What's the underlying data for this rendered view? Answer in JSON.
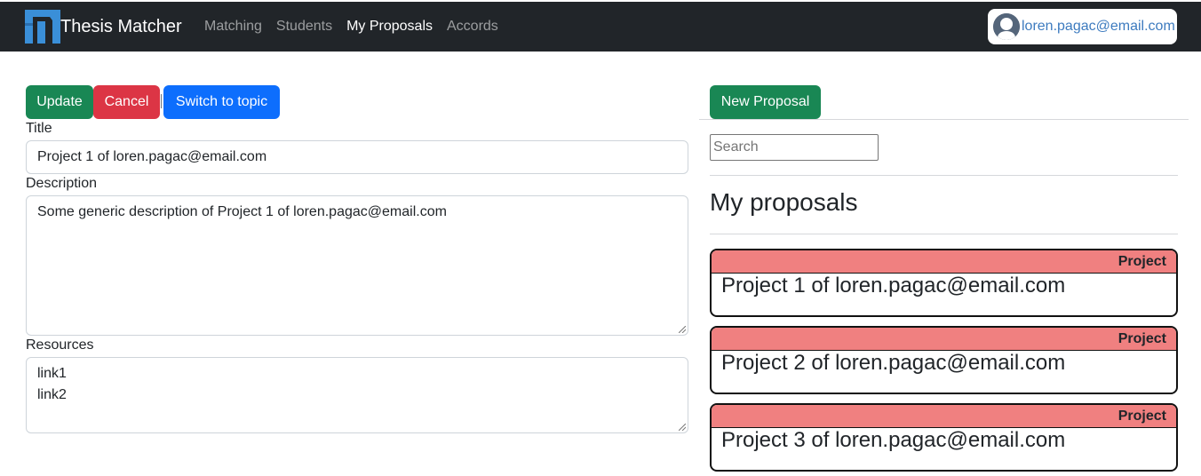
{
  "navbar": {
    "brand": "Thesis Matcher",
    "links": [
      {
        "label": "Matching",
        "active": false
      },
      {
        "label": "Students",
        "active": false
      },
      {
        "label": "My Proposals",
        "active": true
      },
      {
        "label": "Accords",
        "active": false
      }
    ],
    "user_email": "loren.pagac@email.com"
  },
  "form": {
    "buttons": {
      "update": "Update",
      "cancel": "Cancel",
      "switch": "Switch to topic"
    },
    "title_label": "Title",
    "title_value": "Project 1 of loren.pagac@email.com",
    "description_label": "Description",
    "description_value": "Some generic description of Project 1 of loren.pagac@email.com",
    "resources_label": "Resources",
    "resources_lines": [
      "link1",
      "link2"
    ]
  },
  "sidebar": {
    "new_button": "New Proposal",
    "search_placeholder": "Search",
    "heading": "My proposals",
    "proposals": [
      {
        "type": "Project",
        "title": "Project 1 of loren.pagac@email.com"
      },
      {
        "type": "Project",
        "title": "Project 2 of loren.pagac@email.com"
      },
      {
        "type": "Project",
        "title": "Project 3 of loren.pagac@email.com"
      }
    ]
  },
  "colors": {
    "navbar": "#212529",
    "success": "#198754",
    "danger": "#dc3545",
    "primary": "#0d6efd",
    "card_header": "#f08080"
  }
}
